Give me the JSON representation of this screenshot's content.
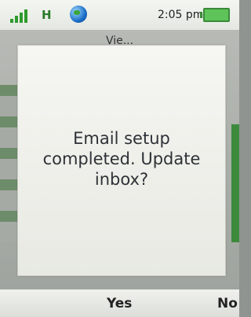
{
  "status_bar": {
    "network_label": "H",
    "time": "2:05 pm"
  },
  "background": {
    "title_fragment": "Vie..."
  },
  "dialog": {
    "message": "Email setup completed. Update inbox?"
  },
  "softkeys": {
    "yes_label": "Yes",
    "no_label": "No"
  }
}
